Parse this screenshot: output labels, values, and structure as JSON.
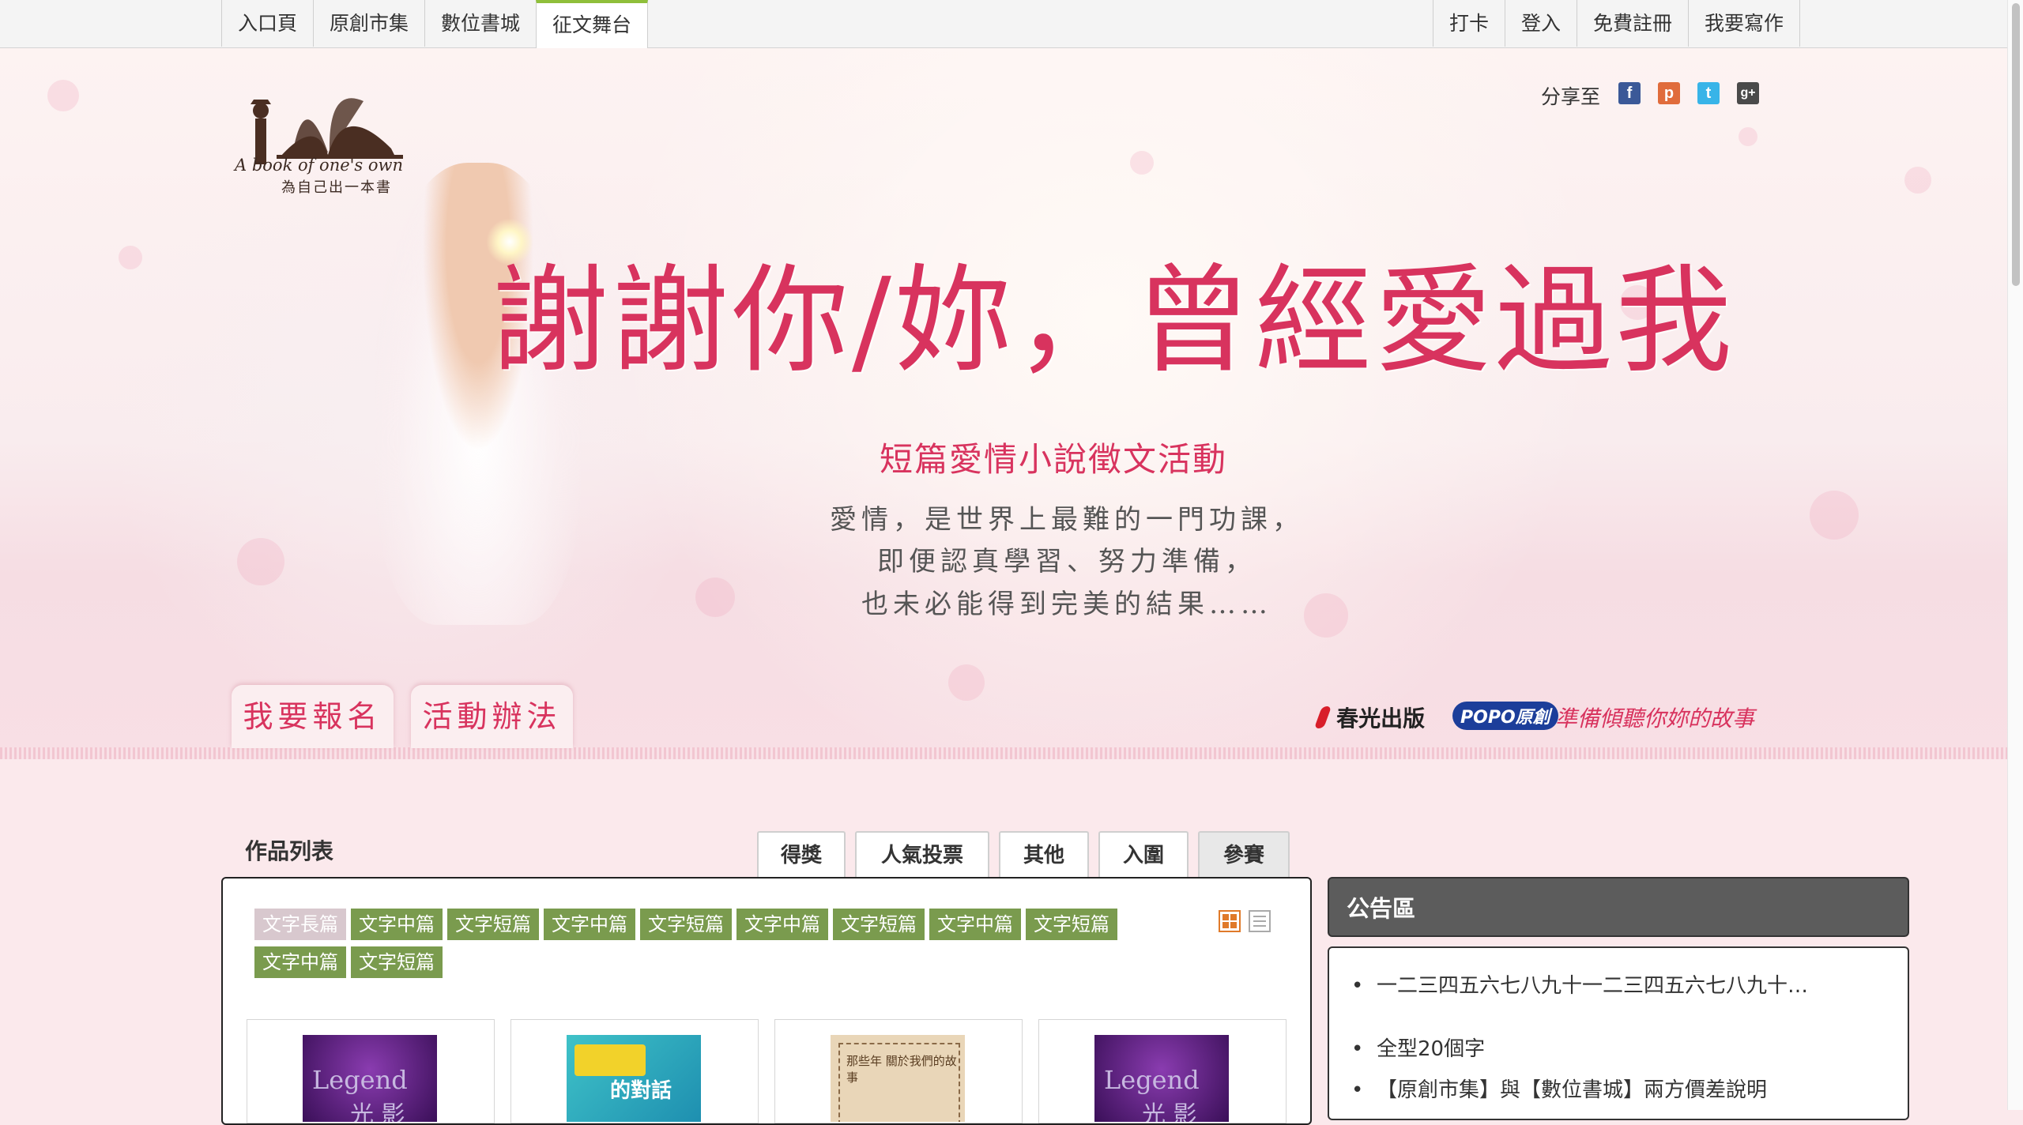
{
  "nav": {
    "left": [
      "入口頁",
      "原創市集",
      "數位書城",
      "征文舞台"
    ],
    "right": [
      "打卡",
      "登入",
      "免費註冊",
      "我要寫作"
    ],
    "active_index": 3,
    "accent_color": "#8fbf3a"
  },
  "logo": {
    "text": "A book of one's own",
    "subtitle": "為自己出一本書"
  },
  "share": {
    "label": "分享至",
    "icons": [
      {
        "name": "facebook-icon",
        "glyph": "f",
        "color": "#3b5998"
      },
      {
        "name": "plurk-icon",
        "glyph": "p",
        "color": "#e06c3c"
      },
      {
        "name": "twitter-icon",
        "glyph": "t",
        "color": "#38b4e8"
      },
      {
        "name": "google-plus-icon",
        "glyph": "g+",
        "color": "#4a4a4a"
      }
    ]
  },
  "hero": {
    "title": "謝謝你/妳，曾經愛過我",
    "subtitle": "短篇愛情小說徵文活動",
    "lines": [
      "愛情，是世界上最難的一門功課，",
      "即便認真學習、努力準備，",
      "也未必能得到完美的結果……"
    ],
    "tabs": [
      "我要報名",
      "活動辦法"
    ],
    "brand_1": "春光出版",
    "brand_2": "POPO原創",
    "slogan": "準備傾聽你妳的故事",
    "title_color": "#d8335e"
  },
  "works": {
    "title": "作品列表",
    "tabs": [
      "得獎",
      "人氣投票",
      "其他",
      "入圍",
      "參賽"
    ],
    "active_tab": 4,
    "tags": [
      "文字長篇",
      "文字中篇",
      "文字短篇",
      "文字中篇",
      "文字短篇",
      "文字中篇",
      "文字短篇",
      "文字中篇",
      "文字短篇",
      "文字中篇",
      "文字短篇"
    ],
    "tag_color": "#7a9b4e",
    "covers": [
      {
        "name": "cover-legend",
        "text": "Legend",
        "sub": "光 影"
      },
      {
        "name": "cover-dialogue",
        "text": "的對話",
        "sub": ""
      },
      {
        "name": "cover-story",
        "text": "那些年 關於我們的故事",
        "sub": ""
      },
      {
        "name": "cover-legend-2",
        "text": "Legend",
        "sub": "光 影"
      }
    ]
  },
  "notice": {
    "title": "公告區",
    "items": [
      "一二三四五六七八九十一二三四五六七八九十…",
      "全型20個字",
      "【原創市集】與【數位書城】兩方價差說明"
    ]
  }
}
